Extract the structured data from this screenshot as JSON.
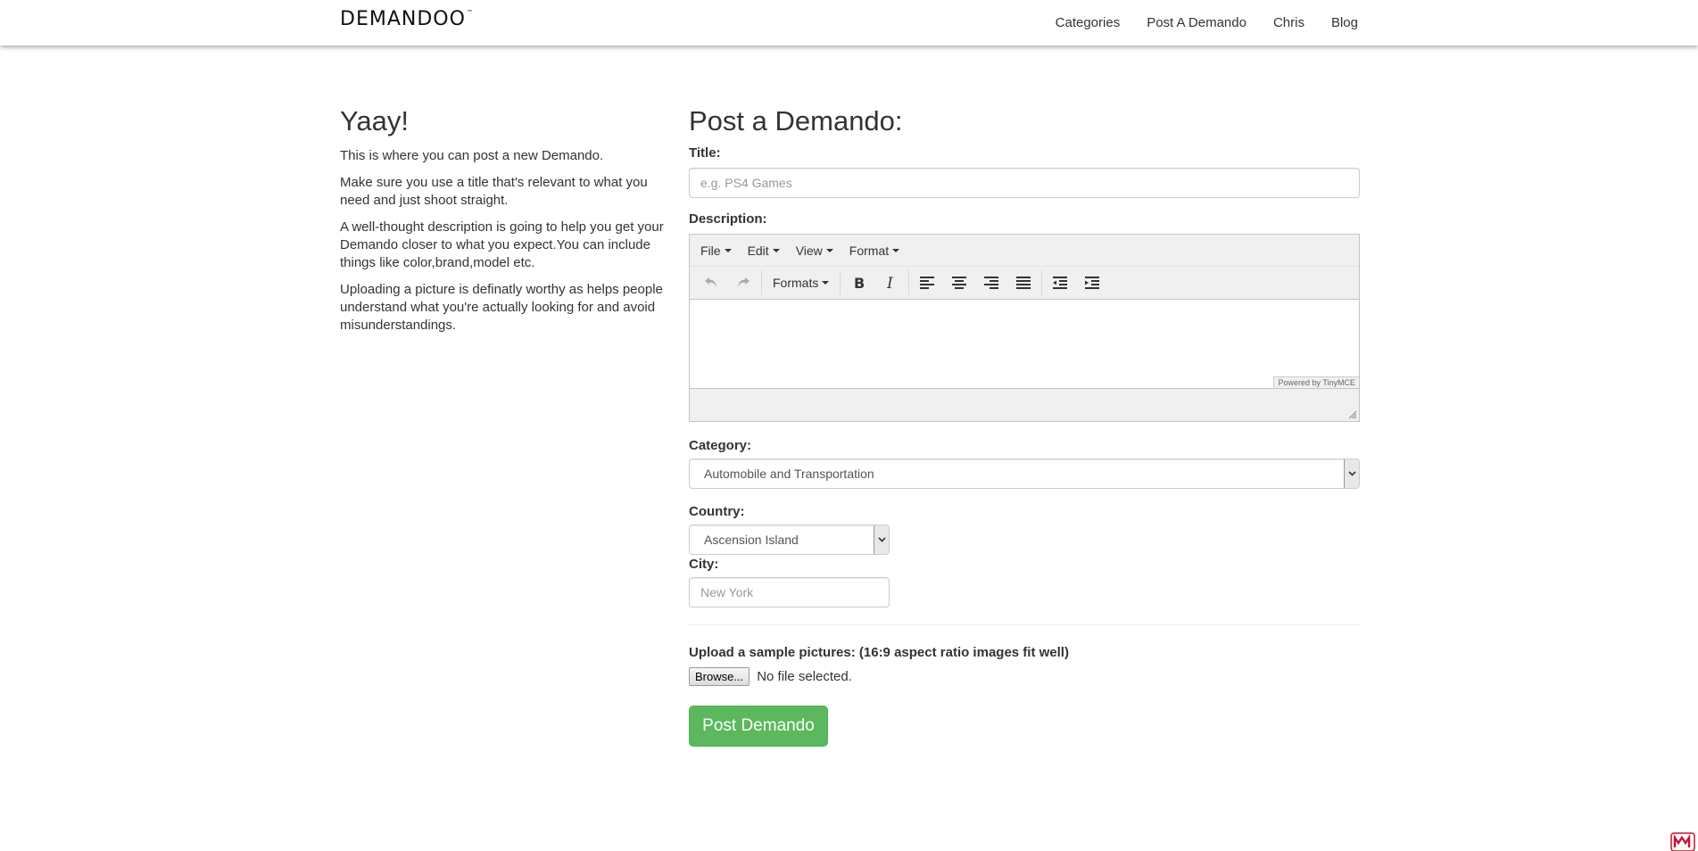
{
  "brand": {
    "logo_text": "DEMANDOO",
    "trademark": "™"
  },
  "nav": {
    "items": [
      "Categories",
      "Post A Demando",
      "Chris",
      "Blog"
    ]
  },
  "intro": {
    "heading": "Yaay!",
    "paragraphs": [
      "This is where you can post a new Demando.",
      "Make sure you use a title that's relevant to what you need and just shoot straight.",
      "A well-thought description is going to help you get your Demando closer to what you expect.You can include things like color,brand,model etc.",
      "Uploading a picture is definatly worthy as helps people understand what you're actually looking for and avoid misunderstandings."
    ]
  },
  "form": {
    "heading": "Post a Demando:",
    "title_label": "Title:",
    "title_placeholder": "e.g. PS4 Games",
    "description_label": "Description:",
    "editor": {
      "menus": [
        "File",
        "Edit",
        "View",
        "Format"
      ],
      "formats_label": "Formats",
      "powered_by": "Powered by TinyMCE"
    },
    "category_label": "Category:",
    "category_value": "Automobile and Transportation",
    "country_label": "Country:",
    "country_value": "Ascension Island",
    "city_label": "City:",
    "city_placeholder": "New York",
    "upload_label": "Upload a sample pictures: (16:9 aspect ratio images fit well)",
    "browse_label": "Browse...",
    "file_status": "No file selected.",
    "submit_label": "Post Demando"
  },
  "colors": {
    "accent_green": "#5cb85c",
    "text": "#333333",
    "badge_red": "#c8102e"
  },
  "icons": [
    "undo-icon",
    "redo-icon",
    "bold-icon",
    "italic-icon",
    "align-left-icon",
    "align-center-icon",
    "align-right-icon",
    "align-justify-icon",
    "outdent-icon",
    "indent-icon",
    "chevron-down-icon",
    "resize-handle-icon",
    "mcafee-icon"
  ]
}
